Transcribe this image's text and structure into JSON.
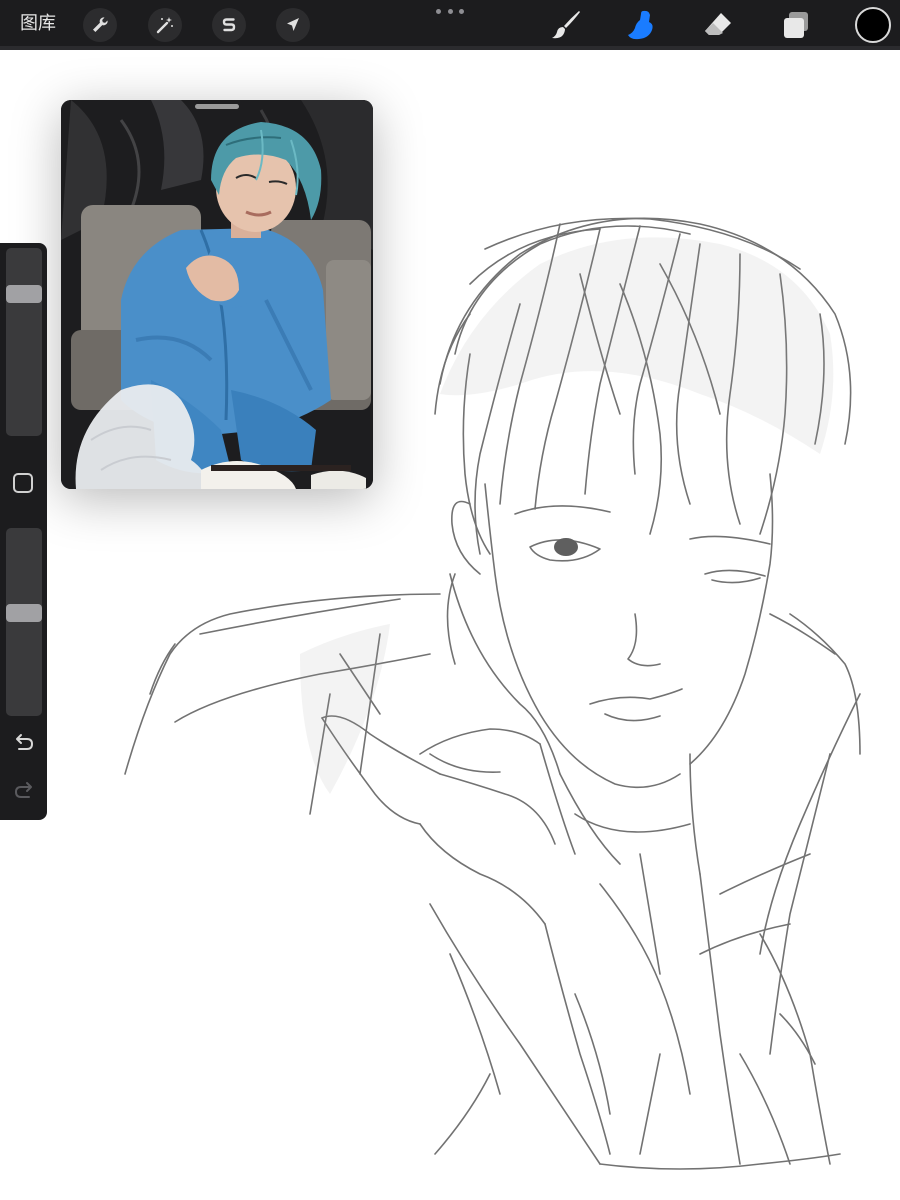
{
  "toolbar": {
    "gallery_label": "图库",
    "left_tools": [
      {
        "name": "actions",
        "icon": "wrench-icon"
      },
      {
        "name": "adjustments",
        "icon": "magic-wand-icon"
      },
      {
        "name": "selection",
        "icon": "selection-s-icon"
      },
      {
        "name": "transform",
        "icon": "arrow-cursor-icon"
      }
    ],
    "right_tools": [
      {
        "name": "brush",
        "icon": "brush-icon",
        "active": false
      },
      {
        "name": "smudge",
        "icon": "smudge-finger-icon",
        "active": true
      },
      {
        "name": "eraser",
        "icon": "eraser-icon",
        "active": false
      },
      {
        "name": "layers",
        "icon": "layers-icon",
        "active": false
      }
    ],
    "active_color": "#000000",
    "accent_color": "#1a7cff"
  },
  "sidebar": {
    "brush_size_level": 0.78,
    "opacity_level": 0.55,
    "undo_icon": "undo-arrow-icon",
    "redo_icon": "redo-arrow-icon",
    "redo_enabled": false,
    "modify_icon": "square-modify-icon"
  },
  "reference": {
    "content": "photo-of-person-in-blue-suit-with-teal-hair"
  }
}
